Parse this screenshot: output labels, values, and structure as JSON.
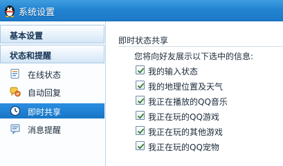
{
  "window": {
    "title": "系统设置",
    "icon": "qq-penguin-icon"
  },
  "sidebar": {
    "groups": [
      {
        "label": "基本设置"
      },
      {
        "label": "状态和提醒"
      }
    ],
    "items": [
      {
        "label": "在线状态",
        "icon": "online-status-icon",
        "selected": false
      },
      {
        "label": "自动回复",
        "icon": "auto-reply-icon",
        "selected": false
      },
      {
        "label": "即时共享",
        "icon": "instant-share-icon",
        "selected": true
      },
      {
        "label": "消息提醒",
        "icon": "message-alert-icon",
        "selected": false
      }
    ]
  },
  "content": {
    "section_title": "即时状态共享",
    "intro": "您将向好友展示以下选中的信息:",
    "options": [
      {
        "label": "我的输入状态",
        "checked": true
      },
      {
        "label": "我的地理位置及天气",
        "checked": true
      },
      {
        "label": "我正在播放的QQ音乐",
        "checked": true
      },
      {
        "label": "我正在玩的QQ游戏",
        "checked": true
      },
      {
        "label": "我正在玩的其他游戏",
        "checked": true
      },
      {
        "label": "我正在玩的QQ宠物",
        "checked": true
      }
    ]
  },
  "colors": {
    "titlebar": "#2384d2",
    "selected": "#1e80d0",
    "checkmark": "#2f7d1e"
  }
}
